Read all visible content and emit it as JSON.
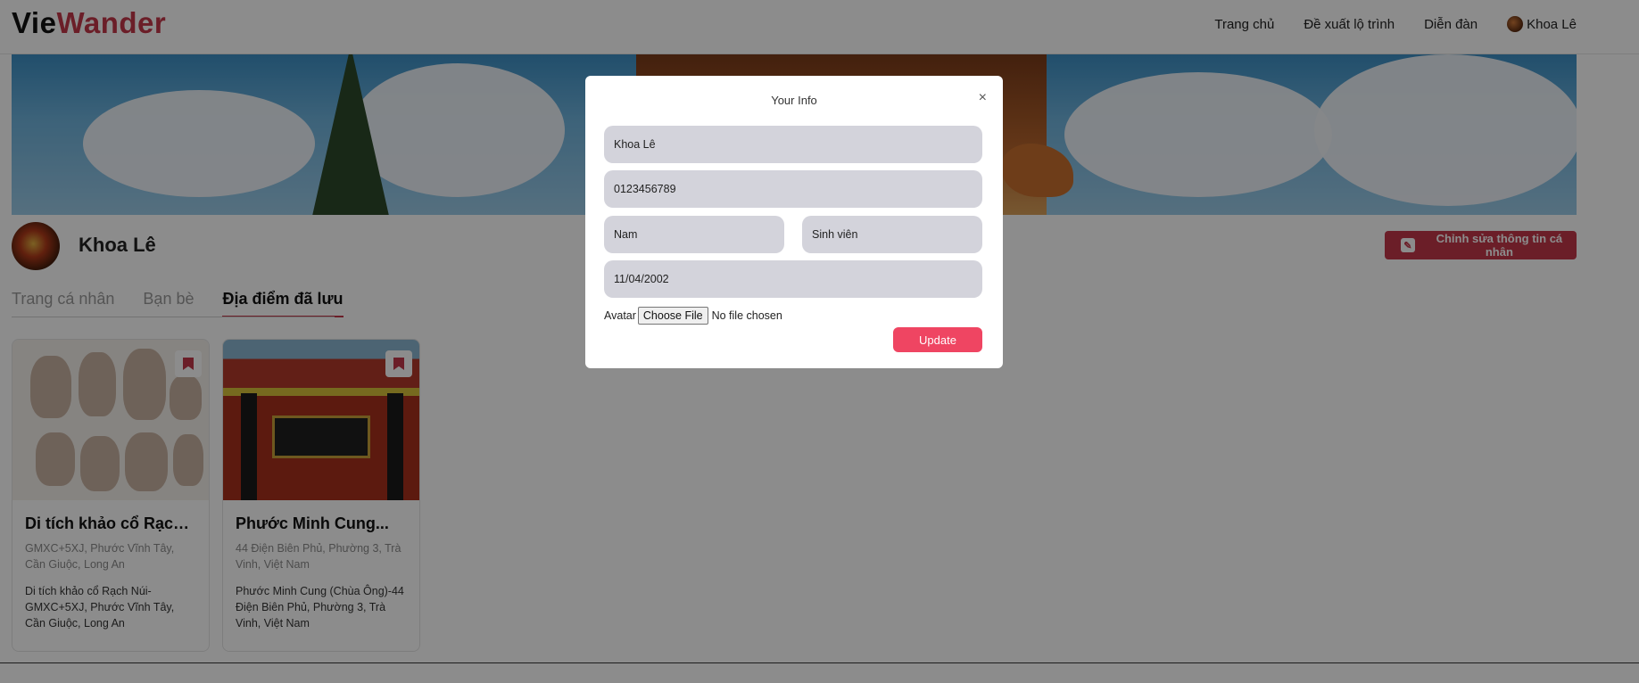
{
  "header": {
    "logo_part1": "Vie",
    "logo_part2": "Wander",
    "nav": [
      "Trang chủ",
      "Đề xuất lộ trình",
      "Diễn đàn"
    ],
    "user_name": "Khoa Lê"
  },
  "profile": {
    "name": "Khoa Lê",
    "edit_label": "Chỉnh sửa thông tin cá nhân"
  },
  "tabs": [
    "Trang cá nhân",
    "Bạn bè",
    "Địa điểm đã lưu"
  ],
  "cards": [
    {
      "title": "Di tích khảo cổ Rạch...",
      "address": "GMXC+5XJ, Phước Vĩnh Tây, Cần Giuộc, Long An",
      "description": "Di tích khảo cổ Rạch Núi-GMXC+5XJ, Phước Vĩnh Tây, Cần Giuộc, Long An"
    },
    {
      "title": "Phước Minh Cung...",
      "address": "44 Điện Biên Phủ, Phường 3, Trà Vinh, Việt Nam",
      "description": "Phước Minh Cung (Chùa Ông)-44 Điện Biên Phủ, Phường 3, Trà Vinh, Việt Nam"
    }
  ],
  "modal": {
    "title": "Your Info",
    "close": "×",
    "name_value": "Khoa Lê",
    "phone_value": "0123456789",
    "gender_value": "Nam",
    "occupation_value": "Sinh viên",
    "dob_value": "11/04/2002",
    "avatar_label": "Avatar",
    "choose_file": "Choose File",
    "no_file": "No file chosen",
    "update_label": "Update"
  },
  "colors": {
    "brand": "#c4384a",
    "update_button": "#ef4562",
    "field_bg": "#d3d3db"
  }
}
